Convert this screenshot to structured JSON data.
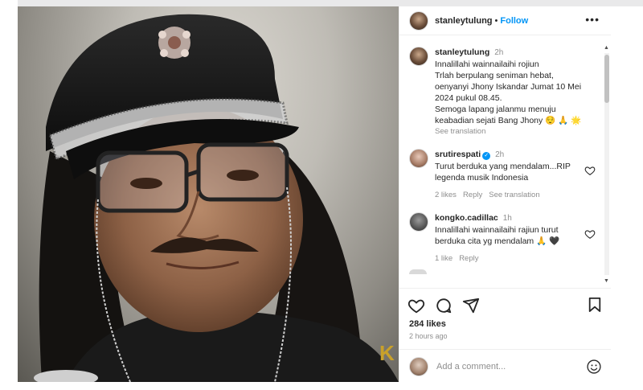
{
  "post": {
    "author": "stanleytulung",
    "separator": "•",
    "follow_label": "Follow",
    "more_label": "•••"
  },
  "caption": {
    "user": "stanleytulung",
    "time": "2h",
    "lines": [
      "Innalillahi wainnailaihi rojiun",
      "Trlah berpulang seniman hebat,",
      "oenyanyi Jhony Iskandar Jumat 10 Mei",
      "2024 pukul 08.45.",
      "Semoga lapang jalanmu menuju",
      "keabadian sejati Bang Jhony 😌 🙏 🌟"
    ],
    "see_translation": "See translation"
  },
  "comments": [
    {
      "user": "srutirespati",
      "verified": true,
      "time": "2h",
      "text_lines": [
        "Turut berduka yang mendalam...RIP",
        "legenda musik Indonesia"
      ],
      "likes": "2 likes",
      "reply": "Reply",
      "see_translation": "See translation"
    },
    {
      "user": "kongko.cadillac",
      "verified": false,
      "time": "1h",
      "text_lines": [
        "Innalillahi wainnailaihi rajiun turut",
        "berduka cita yg mendalam 🙏 🖤"
      ],
      "likes": "1 like",
      "reply": "Reply"
    }
  ],
  "actions": {
    "likes_count": "284 likes",
    "time_ago": "2 hours ago",
    "add_comment_placeholder": "Add a comment..."
  },
  "icons": {
    "like": "heart-icon",
    "comment": "comment-icon",
    "share": "share-icon",
    "save": "bookmark-icon",
    "emoji": "emoji-icon",
    "more": "more-icon"
  },
  "colors": {
    "accent": "#0095f6",
    "muted": "#8e8e8e",
    "text": "#262626"
  },
  "photo": {
    "watermark": "K"
  }
}
